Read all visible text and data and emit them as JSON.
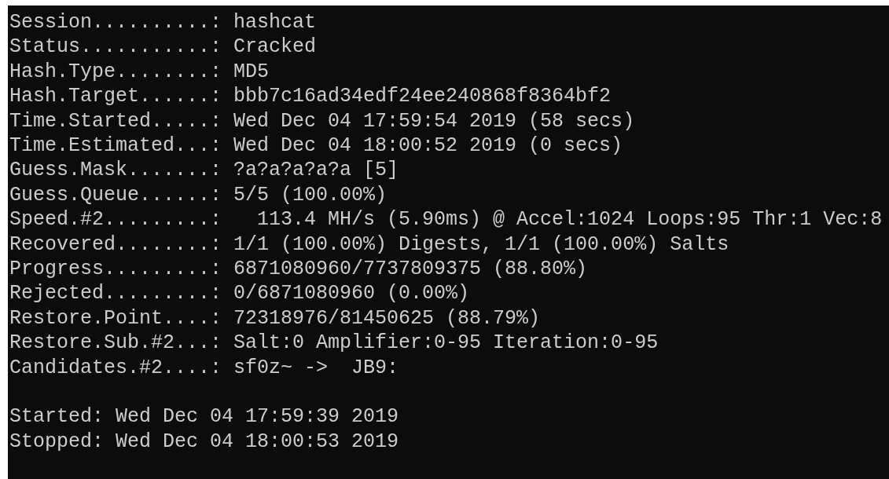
{
  "terminal": {
    "lines": [
      {
        "kind": "output",
        "text": "Session..........: hashcat"
      },
      {
        "kind": "output",
        "text": "Status...........: Cracked"
      },
      {
        "kind": "output",
        "text": "Hash.Type........: MD5"
      },
      {
        "kind": "output",
        "text": "Hash.Target......: bbb7c16ad34edf24ee240868f8364bf2"
      },
      {
        "kind": "output",
        "text": "Time.Started.....: Wed Dec 04 17:59:54 2019 (58 secs)"
      },
      {
        "kind": "output",
        "text": "Time.Estimated...: Wed Dec 04 18:00:52 2019 (0 secs)"
      },
      {
        "kind": "output",
        "text": "Guess.Mask.......: ?a?a?a?a?a [5]"
      },
      {
        "kind": "output",
        "text": "Guess.Queue......: 5/5 (100.00%)"
      },
      {
        "kind": "output",
        "text": "Speed.#2.........:   113.4 MH/s (5.90ms) @ Accel:1024 Loops:95 Thr:1 Vec:8"
      },
      {
        "kind": "output",
        "text": "Recovered........: 1/1 (100.00%) Digests, 1/1 (100.00%) Salts"
      },
      {
        "kind": "output",
        "text": "Progress.........: 6871080960/7737809375 (88.80%)"
      },
      {
        "kind": "output",
        "text": "Rejected.........: 0/6871080960 (0.00%)"
      },
      {
        "kind": "output",
        "text": "Restore.Point....: 72318976/81450625 (88.79%)"
      },
      {
        "kind": "output",
        "text": "Restore.Sub.#2...: Salt:0 Amplifier:0-95 Iteration:0-95"
      },
      {
        "kind": "output",
        "text": "Candidates.#2....: sf0z~ ->  JB9:"
      },
      {
        "kind": "blank"
      },
      {
        "kind": "output",
        "text": "Started: Wed Dec 04 17:59:39 2019"
      },
      {
        "kind": "output",
        "text": "Stopped: Wed Dec 04 18:00:53 2019"
      }
    ]
  }
}
